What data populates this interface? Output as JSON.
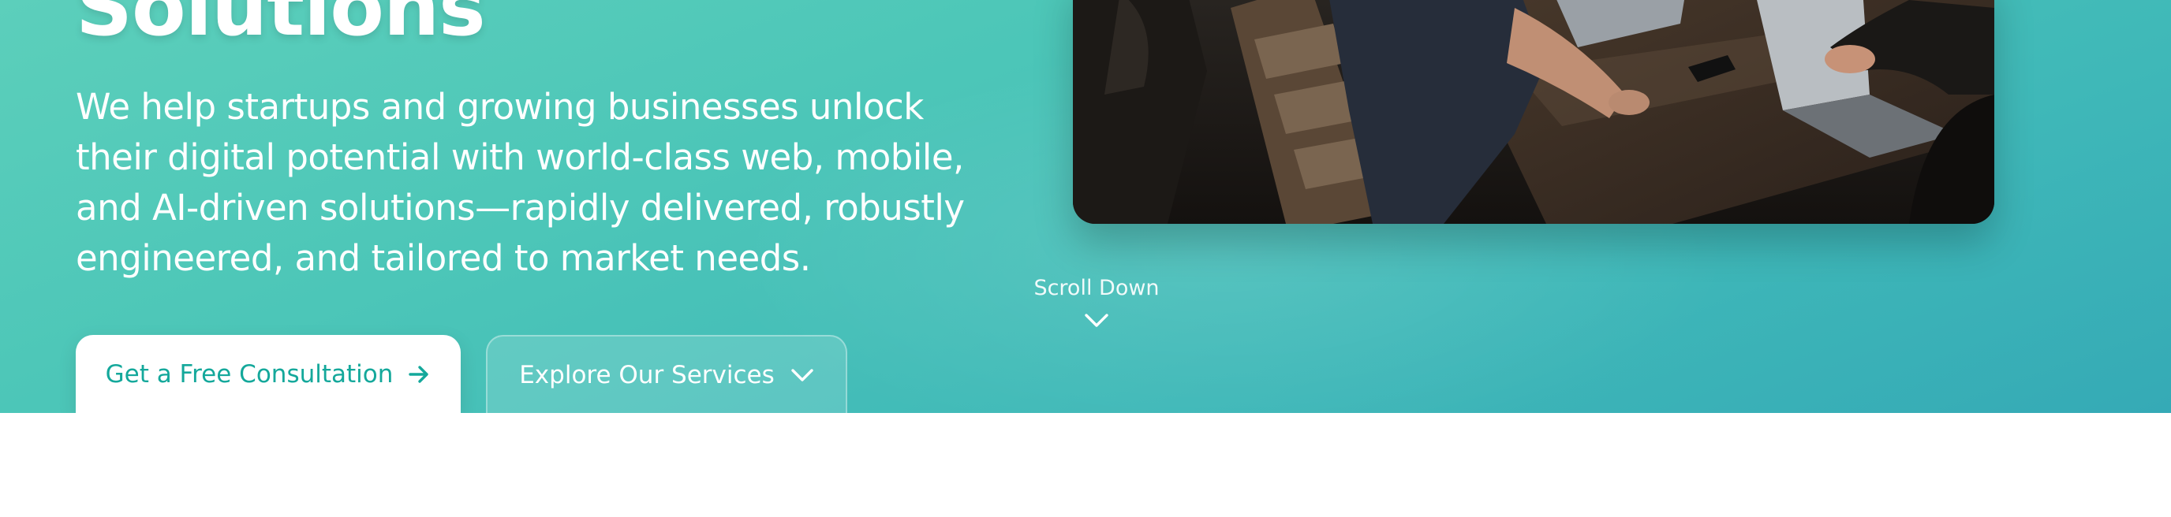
{
  "hero": {
    "headline": "Solutions",
    "subtext": "We help startups and growing businesses unlock their digital potential with world-class web, mobile, and AI-driven solutions—rapidly delivered, robustly engineered, and tailored to market needs.",
    "primary_cta": {
      "label": "Get a Free Consultation",
      "icon": "arrow-right-icon"
    },
    "secondary_cta": {
      "label": "Explore Our Services",
      "icon": "chevron-down-icon"
    },
    "image": {
      "subject": "team-working-on-laptops-photo"
    },
    "scroll": {
      "label": "Scroll Down",
      "icon": "chevron-down-icon"
    }
  },
  "colors": {
    "gradient_start": "#5ccfbb",
    "gradient_end": "#35aab6",
    "primary_button_text": "#14a89b",
    "white": "#ffffff"
  }
}
